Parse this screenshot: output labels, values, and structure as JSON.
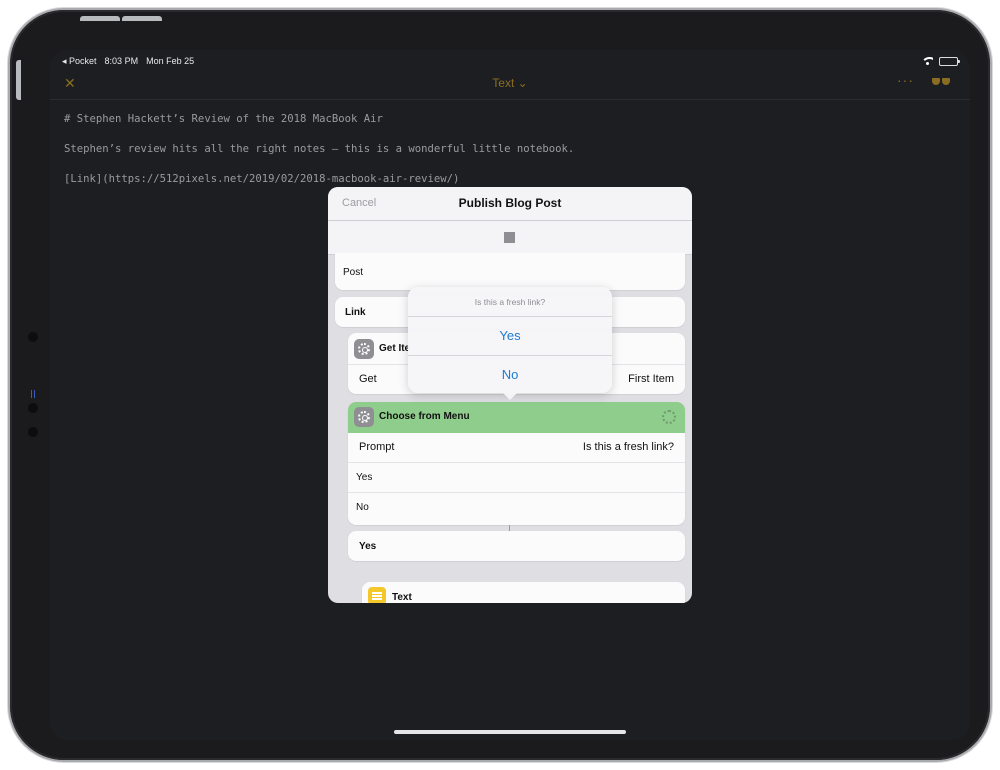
{
  "status_bar": {
    "back_app": "◂ Pocket",
    "time": "8:03 PM",
    "date": "Mon Feb 25"
  },
  "editor_nav": {
    "close_glyph": "✕",
    "title": "Text",
    "title_chevron": "⌄",
    "more_glyph": "···"
  },
  "editor": {
    "lines": [
      "# Stephen Hackett’s Review of the 2018 MacBook Air",
      "Stephen’s review hits all the right notes — this is a wonderful little notebook.",
      "[Link](https://512pixels.net/2019/02/2018-macbook-air-review/)"
    ]
  },
  "sheet": {
    "cancel_label": "Cancel",
    "title": "Publish Blog Post",
    "actions": {
      "post_label": "Post",
      "link_label": "Link",
      "get_item": {
        "title": "Get Ite",
        "param_label": "Get",
        "param_value": "First Item"
      },
      "choose_from_menu": {
        "title": "Choose from Menu",
        "prompt_label": "Prompt",
        "prompt_value": "Is this a fresh link?",
        "options": [
          "Yes",
          "No"
        ]
      },
      "yes_block_label": "Yes",
      "text_action_title": "Text"
    }
  },
  "popover": {
    "prompt": "Is this a fresh link?",
    "options": [
      "Yes",
      "No"
    ]
  },
  "colors": {
    "editor_accent": "#8a6d22",
    "menu_header": "#8fcd8c",
    "popover_option": "#1e7ad2"
  }
}
